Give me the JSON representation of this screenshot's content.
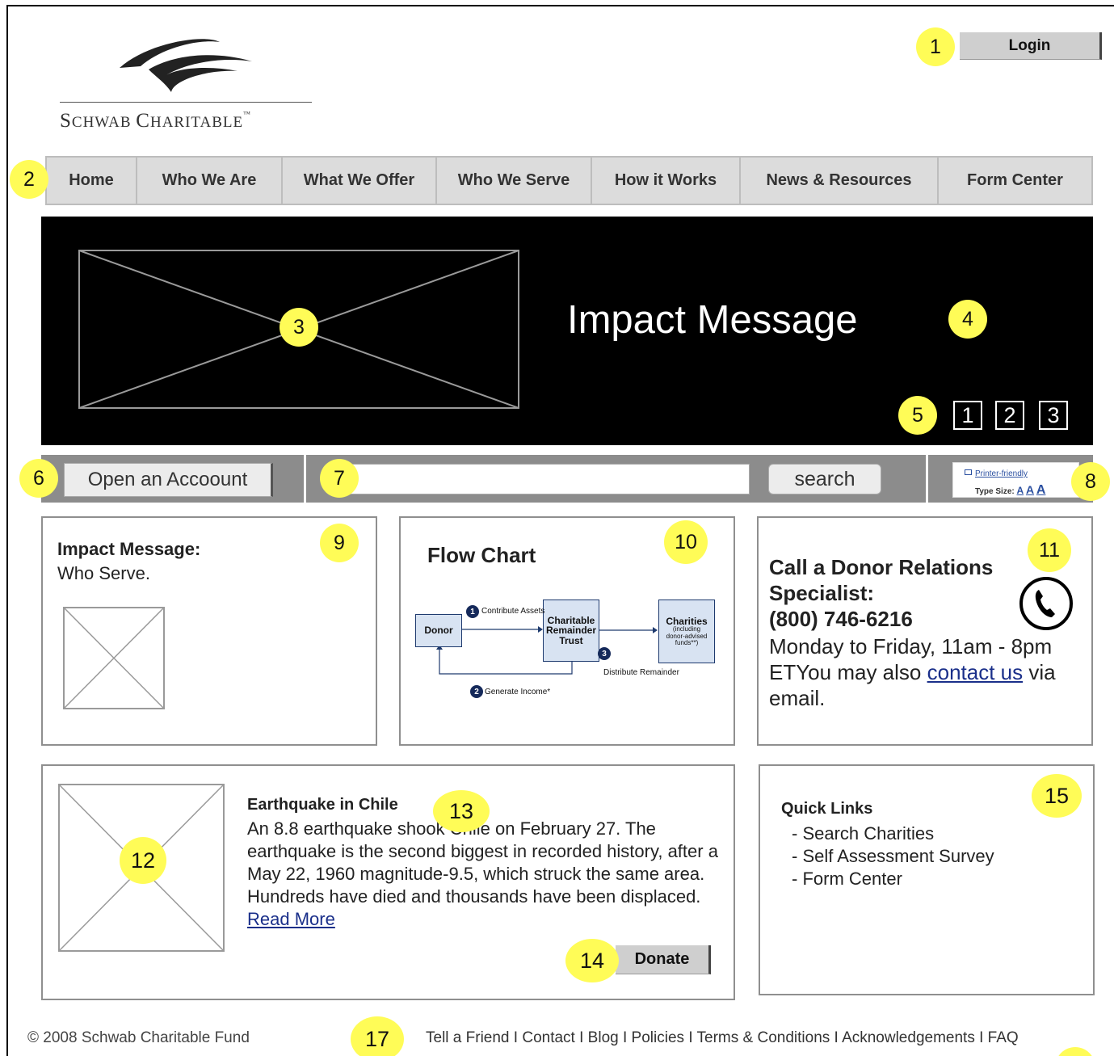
{
  "logo": {
    "text_first": "S",
    "text_rest": "CHWAB ",
    "text_first2": "C",
    "text_rest2": "HARITABLE",
    "tm": "™"
  },
  "header": {
    "login_label": "Login"
  },
  "nav": {
    "items": [
      {
        "label": "Home"
      },
      {
        "label": "Who We Are"
      },
      {
        "label": "What We Offer"
      },
      {
        "label": "Who We Serve"
      },
      {
        "label": "How it Works"
      },
      {
        "label": "News & Resources"
      },
      {
        "label": "Form Center"
      }
    ]
  },
  "hero": {
    "title": "Impact Message",
    "slides": [
      "1",
      "2",
      "3"
    ]
  },
  "toolbar": {
    "open_account_label": "Open an Accoount",
    "search_value": "",
    "search_label": "search",
    "printer_friendly": "Printer-friendly",
    "type_size_label": "Type Size:",
    "type_sizes": [
      "A",
      "A",
      "A"
    ]
  },
  "card_impact": {
    "heading": "Impact Message:",
    "subtext": "Who Serve."
  },
  "card_flow": {
    "heading": "Flow Chart",
    "donor": "Donor",
    "trust_line1": "Charitable",
    "trust_line2": "Remainder",
    "trust_line3": "Trust",
    "charities_title": "Charities",
    "charities_sub1": "(including",
    "charities_sub2": "donor-advised",
    "charities_sub3": "funds**)",
    "step1_num": "1",
    "step1": "Contribute Assets",
    "step2_num": "2",
    "step2": "Generate Income*",
    "step3_num": "3",
    "step3": "Distribute Remainder"
  },
  "card_contact": {
    "heading_line1": "Call a Donor Relations",
    "heading_line2": "Specialist:",
    "phone": "(800) 746-6216",
    "hours": "Monday to Friday, 11am - 8pm ETYou may also",
    "link_text": "contact us",
    "trailing": "via email.",
    "icon": "phone-icon"
  },
  "news": {
    "title": "Earthquake in Chile",
    "body": "An 8.8 earthquake shook Chile on February 27. The earthquake is the second biggest in recorded history, after a May 22, 1960 magnitude-9.5, which struck the same area. Hundreds have died and thousands have been displaced.",
    "read_more": "Read More",
    "donate_label": "Donate"
  },
  "quick_links": {
    "heading": "Quick Links",
    "items": [
      "- Search Charities",
      "- Self Assessment Survey",
      "- Form Center"
    ]
  },
  "footer": {
    "copyright": "© 2008 Schwab Charitable Fund",
    "links": [
      "Tell a Friend",
      "Contact",
      "Blog",
      "Policies",
      "Terms & Conditions",
      "Acknowledgements",
      "FAQ"
    ],
    "separator": "I"
  },
  "annotations": [
    "1",
    "2",
    "3",
    "4",
    "5",
    "6",
    "7",
    "8",
    "9",
    "10",
    "11",
    "12",
    "13",
    "14",
    "15",
    "17"
  ],
  "colors": {
    "highlight": "#fffc57",
    "hero_bg": "#000000",
    "toolbar_bg": "#8c8c8c",
    "nav_bg": "#dcdcdc",
    "link": "#1a2f8a"
  }
}
